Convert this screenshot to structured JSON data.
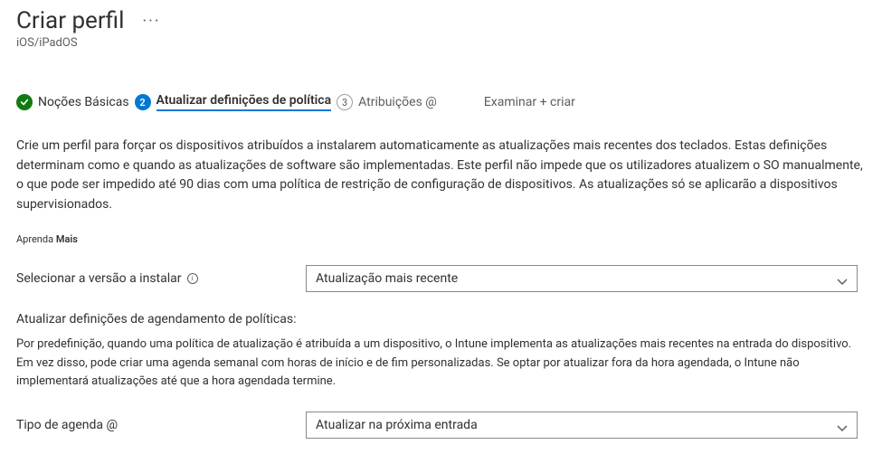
{
  "header": {
    "title": "Criar perfil",
    "subtitle": "iOS/iPadOS"
  },
  "stepper": {
    "step1": {
      "label": "Noções Básicas"
    },
    "step2": {
      "num": "2",
      "label": "Atualizar definições de política"
    },
    "step3": {
      "num": "3",
      "label": "Atribuições @"
    },
    "step4": {
      "label": "Examinar + criar"
    }
  },
  "body": {
    "description": "Crie um perfil para forçar os dispositivos atribuídos a instalarem automaticamente as atualizações mais recentes dos teclados. Estas definições determinam como e quando as atualizações de software são implementadas. Este perfil não impede que os utilizadores atualizem o SO manualmente, o que pode ser impedido até 90 dias com uma política de restrição de configuração de dispositivos. As atualizações só se aplicarão a dispositivos supervisionados.",
    "learn_more_a": "Aprenda",
    "learn_more_b": "Mais",
    "version_label": "Selecionar a versão a instalar",
    "version_value": "Atualização mais recente",
    "schedule_heading": "Atualizar definições de agendamento de políticas:",
    "schedule_desc": "Por predefinição, quando uma política de atualização é atribuída a um dispositivo, o Intune implementa as atualizações mais recentes na entrada do dispositivo. Em vez disso, pode criar uma agenda semanal com horas de início e de fim personalizadas. Se optar por atualizar fora da hora agendada, o Intune não implementará atualizações até que a hora agendada termine.",
    "schedule_type_label": "Tipo de agenda @",
    "schedule_type_value": "Atualizar na próxima entrada"
  }
}
